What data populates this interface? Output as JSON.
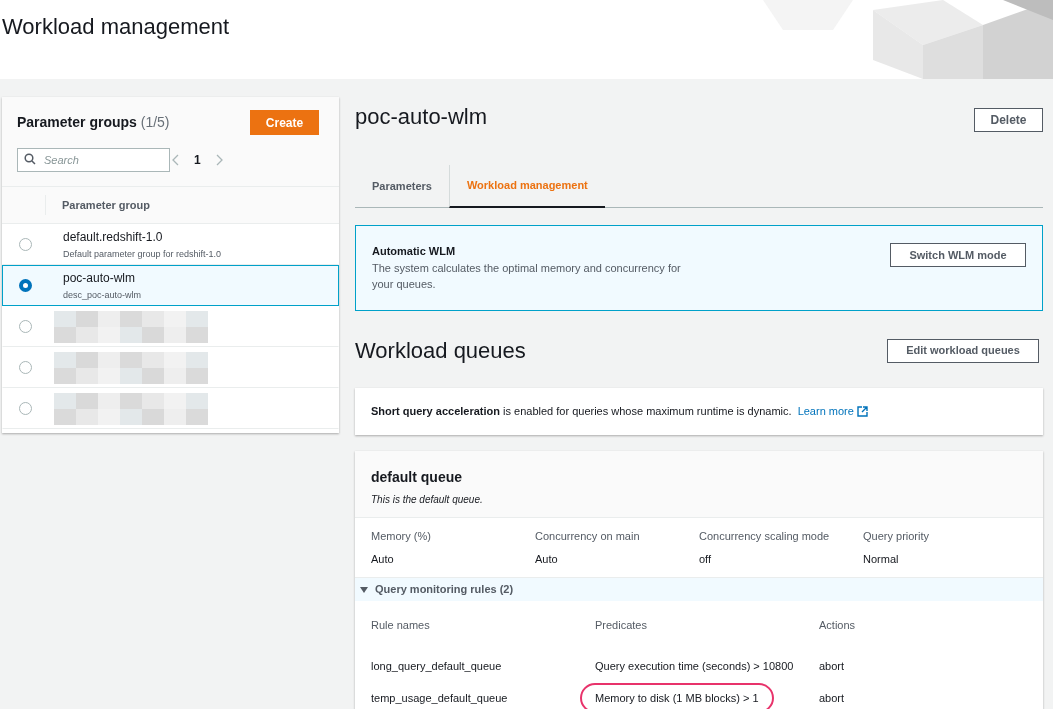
{
  "page_title": "Workload management",
  "parameter_groups": {
    "title": "Parameter groups",
    "count": "(1/5)",
    "create_label": "Create",
    "search": {
      "placeholder": "Search"
    },
    "page": "1",
    "column": "Parameter group",
    "rows": [
      {
        "kind": "item",
        "name": "default.redshift-1.0",
        "description": "Default parameter group for redshift-1.0",
        "selected": false
      },
      {
        "kind": "item",
        "name": "poc-auto-wlm",
        "description": "desc_poc-auto-wlm",
        "selected": true
      },
      {
        "kind": "redacted",
        "selected": false
      },
      {
        "kind": "redacted",
        "selected": false
      },
      {
        "kind": "redacted",
        "selected": false
      }
    ]
  },
  "detail": {
    "title": "poc-auto-wlm",
    "delete_label": "Delete",
    "tabs": [
      {
        "label": "Parameters",
        "selected": false
      },
      {
        "label": "Workload management",
        "selected": true
      }
    ],
    "info": {
      "title": "Automatic WLM",
      "text": "The system calculates the optimal memory and concurrency for your queues.",
      "button": "Switch WLM mode"
    },
    "queues_title": "Workload queues",
    "edit_label": "Edit workload queues",
    "sqa": {
      "text": "**Short query acceleration** is enabled for queries whose maximum runtime is dynamic.",
      "link": "Learn more"
    },
    "queue": {
      "title": "default queue",
      "subtitle": "This is the default queue.",
      "fields": [
        {
          "label": "Memory (%)",
          "value": "Auto"
        },
        {
          "label": "Concurrency on main",
          "value": "Auto"
        },
        {
          "label": "Concurrency scaling mode",
          "value": "off"
        },
        {
          "label": "Query priority",
          "value": "Normal"
        }
      ],
      "rules": {
        "title": "Query monitoring rules (2)",
        "expanded": true,
        "columns": [
          "Rule names",
          "Predicates",
          "Actions"
        ],
        "rows": [
          {
            "cells": [
              "long_query_default_queue",
              "Query execution time (seconds) > 10800",
              "abort"
            ],
            "highlighted": false
          },
          {
            "cells": [
              "temp_usage_default_queue",
              "Memory to disk (1 MB blocks) > 1",
              "abort"
            ],
            "highlighted": true
          }
        ]
      }
    }
  }
}
